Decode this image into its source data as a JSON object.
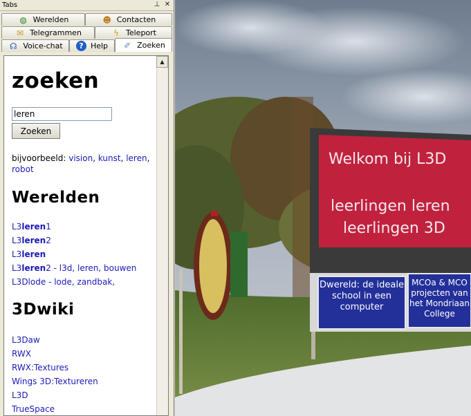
{
  "window": {
    "title": "Tabs",
    "pin_icon": "pin-icon",
    "close_icon": "close-icon"
  },
  "tabs": [
    {
      "label": "Werelden",
      "icon": "globe-icon"
    },
    {
      "label": "Contacten",
      "icon": "contacts-icon"
    },
    {
      "label": "Telegrammen",
      "icon": "envelope-icon"
    },
    {
      "label": "Teleport",
      "icon": "lightning-icon"
    },
    {
      "label": "Voice-chat",
      "icon": "headset-icon"
    },
    {
      "label": "Help",
      "icon": "help-icon"
    },
    {
      "label": "Zoeken",
      "icon": "broom-icon",
      "active": true
    }
  ],
  "search": {
    "title": "zoeken",
    "input_value": "leren",
    "button_label": "Zoeken",
    "example_prefix": "bijvoorbeeld:",
    "examples": [
      "vision",
      "kunst",
      "leren",
      "robot"
    ]
  },
  "werelden": {
    "heading": "Werelden",
    "items": [
      {
        "pre": "L3",
        "bold": "leren",
        "post": "1"
      },
      {
        "pre": "L3",
        "bold": "leren",
        "post": "2"
      },
      {
        "pre": "L3",
        "bold": "leren",
        "post": ""
      },
      {
        "pre": "L3",
        "bold": "leren",
        "post": "2 - l3d, leren, bouwen"
      },
      {
        "pre": "L3Dlode - lode, zandbak,",
        "bold": "",
        "post": ""
      }
    ]
  },
  "wiki": {
    "heading": "3Dwiki",
    "items": [
      "L3Daw",
      "RWX",
      "RWX:Textures",
      "Wings 3D:Textureren",
      "L3D",
      "TrueSpace"
    ]
  },
  "scene": {
    "board_text_1": "Welkom bij L3D",
    "board_text_2": "leerlingen leren",
    "board_text_3": "leerlingen 3D",
    "panel_1": "Dwereld: de ideale school in een computer",
    "panel_2": "MCOa & MCO projecten van het Mondriaan College",
    "colors": {
      "board_red": "#c0223e",
      "panel_blue": "#23309a",
      "sky": "#9aa6b4",
      "grass": "#5e7a38"
    }
  }
}
